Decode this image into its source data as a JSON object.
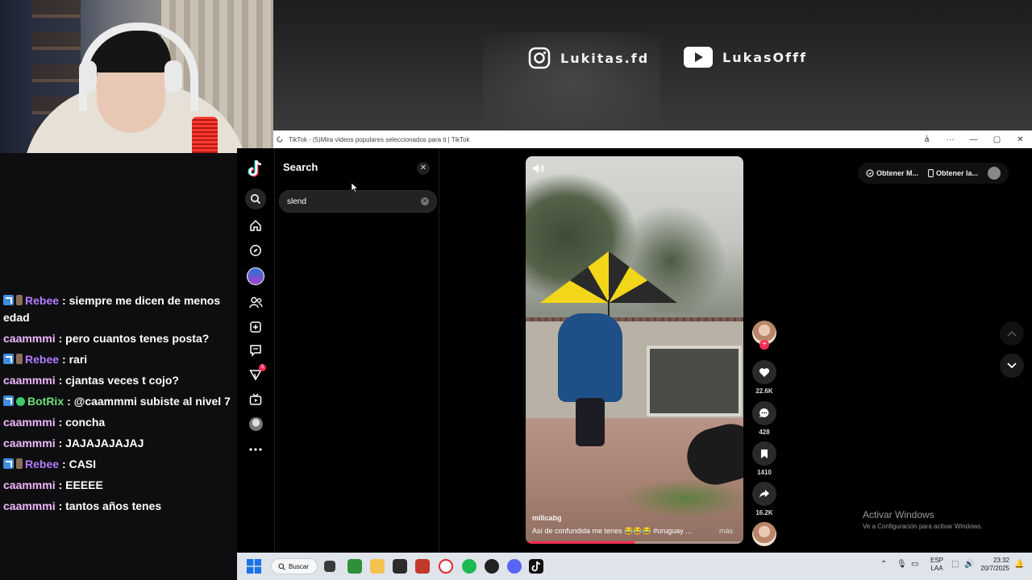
{
  "overlay": {
    "instagram_handle": "Lukitas.fd",
    "youtube_handle": "LukasOfff"
  },
  "chat": {
    "messages": [
      {
        "user": "Rebee",
        "text": ": siempre me dicen de menos edad",
        "color": "#b27cff",
        "badges": [
          "blue",
          "flag"
        ]
      },
      {
        "user": "caammmi",
        "text": ": pero cuantos tenes posta?",
        "color": "#f0b8ff",
        "badges": []
      },
      {
        "user": "Rebee",
        "text": ": rari",
        "color": "#b27cff",
        "badges": [
          "blue",
          "flag"
        ]
      },
      {
        "user": "caammmi",
        "text": ": cjantas veces t cojo?",
        "color": "#f0b8ff",
        "badges": []
      },
      {
        "user": "BotRix",
        "text": ": @caammmi subiste al nivel 7",
        "color": "#6ee07a",
        "badges": [
          "blue",
          "check"
        ]
      },
      {
        "user": "caammmi",
        "text": ": concha",
        "color": "#f0b8ff",
        "badges": []
      },
      {
        "user": "caammmi",
        "text": ": JAJAJAJAJAJ",
        "color": "#f0b8ff",
        "badges": []
      },
      {
        "user": "Rebee",
        "text": ": CASI",
        "color": "#b27cff",
        "badges": [
          "blue",
          "flag"
        ]
      },
      {
        "user": "caammmi",
        "text": ": EEEEE",
        "color": "#f0b8ff",
        "badges": []
      },
      {
        "user": "caammmi",
        "text": ": tantos años tenes",
        "color": "#f0b8ff",
        "badges": []
      }
    ]
  },
  "window": {
    "title": "TikTok - (5)Mira videos populares seleccionados para ti | TikTok",
    "controls": [
      "a҆",
      "···",
      "—",
      "▢",
      "✕"
    ]
  },
  "nav": {
    "icons": [
      "tiktok-logo-icon",
      "search-icon",
      "home-icon",
      "explore-icon",
      "live-avatar-icon",
      "following-icon",
      "upload-icon",
      "messages-icon",
      "inbox-icon",
      "live-icon",
      "profile-icon",
      "more-icon"
    ],
    "inbox_badge": "5"
  },
  "search": {
    "title": "Search",
    "query": "slend"
  },
  "video": {
    "username": "milicabg",
    "caption": "Así de confundida me tenes 😂😂😂 #uruguay ...",
    "more_label": "más",
    "progress": 0.5,
    "likes": "22.6K",
    "comments": "428",
    "saves": "1410",
    "shares": "16.2K"
  },
  "topbar": {
    "get_coins": "Obtener M...",
    "get_app": "Obtener la..."
  },
  "windows_notice": {
    "line1": "Activar Windows",
    "line2": "Ve a Configuración para activar Windows."
  },
  "taskbar": {
    "search_label": "Buscar",
    "lang_top": "ESP",
    "lang_bottom": "LAA",
    "time": "23:32",
    "date": "20/7/2025"
  },
  "colors": {
    "tiktok_red": "#fe2c55",
    "chat_bg": "#0e0e10"
  }
}
